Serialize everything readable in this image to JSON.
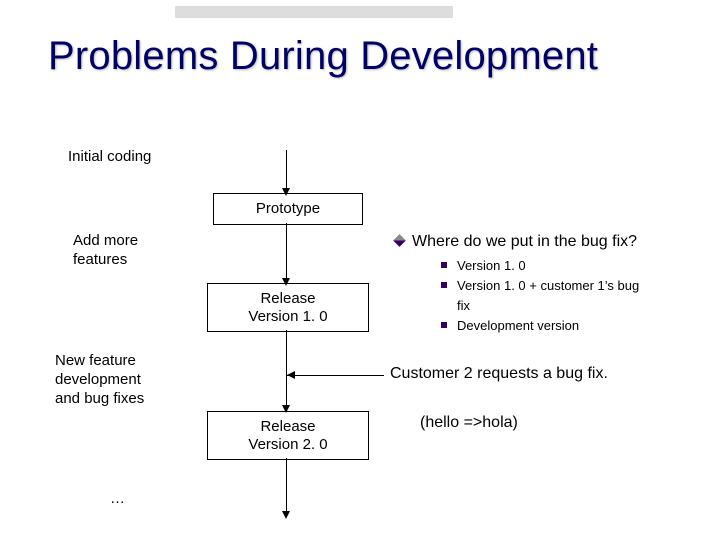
{
  "title": "Problems During Development",
  "labels": {
    "initial_coding": "Initial coding",
    "add_more_features_l1": "Add more",
    "add_more_features_l2": "features",
    "new_feature_l1": "New feature",
    "new_feature_l2": "development",
    "new_feature_l3": "and bug fixes",
    "ellipsis": "…"
  },
  "flow": {
    "prototype": "Prototype",
    "release1_l1": "Release",
    "release1_l2": "Version 1. 0",
    "release2_l1": "Release",
    "release2_l2": "Version 2. 0"
  },
  "question": "Where do we put in the bug fix?",
  "options": {
    "o1": "Version 1. 0",
    "o2a": "Version 1. 0 + customer 1’s bug",
    "o2b": "fix",
    "o3": "Development version"
  },
  "customer2": "Customer 2 requests a bug fix.",
  "hello_hola": "(hello =>hola)"
}
